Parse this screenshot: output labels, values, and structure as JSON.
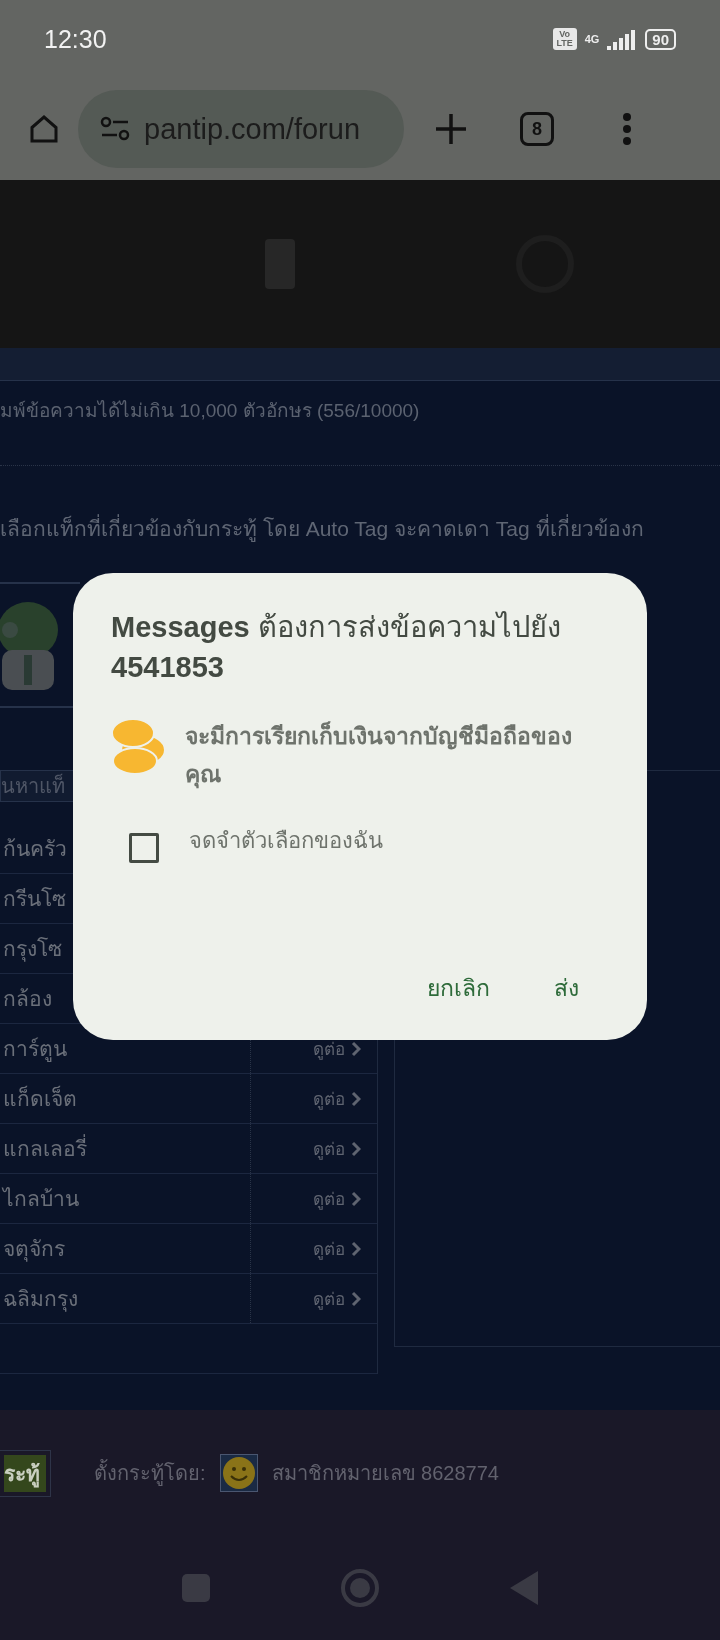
{
  "status_bar": {
    "time": "12:30",
    "volte": "Vo LTE",
    "network": "4G",
    "battery": "90"
  },
  "browser": {
    "url": "pantip.com/forun",
    "tab_count": "8"
  },
  "page": {
    "char_limit_note": "มพ์ข้อความได้ไม่เกิน 10,000 ตัวอักษร (556/10000)",
    "tag_hint": "เลือกแท็กที่เกี่ยวข้องกับกระทู้ โดย Auto Tag จะคาดเดา Tag ที่เกี่ยวข้องก",
    "tag_search": {
      "placeholder": "นหาแท็"
    },
    "tags": [
      {
        "name": "ก้นครัว"
      },
      {
        "name": "กรีนโซ"
      },
      {
        "name": "กรุงโซ"
      },
      {
        "name": "กล้อง"
      },
      {
        "name": "การ์ตูน",
        "more": "ดูต่อ"
      },
      {
        "name": "แก็ดเจ็ต",
        "more": "ดูต่อ"
      },
      {
        "name": "แกลเลอรี่",
        "more": "ดูต่อ"
      },
      {
        "name": "ไกลบ้าน",
        "more": "ดูต่อ"
      },
      {
        "name": "จตุจักร",
        "more": "ดูต่อ"
      },
      {
        "name": "ฉลิมกรุง",
        "more": "ดูต่อ"
      }
    ]
  },
  "footer": {
    "post_button": "ระทู้",
    "posted_by_label": "ตั้งกระทู้โดย:",
    "member": "สมาชิกหมายเลข 8628774"
  },
  "dialog": {
    "title": "**Messages** ต้องการส่งข้อความไปยัง **4541853**",
    "warning": "จะมีการเรียกเก็บเงินจากบัญชีมือถือของคุณ",
    "remember": {
      "label": "จดจำตัวเลือกของฉัน",
      "checked": false
    },
    "buttons": [
      "ยกเลิก",
      "ส่ง"
    ]
  }
}
